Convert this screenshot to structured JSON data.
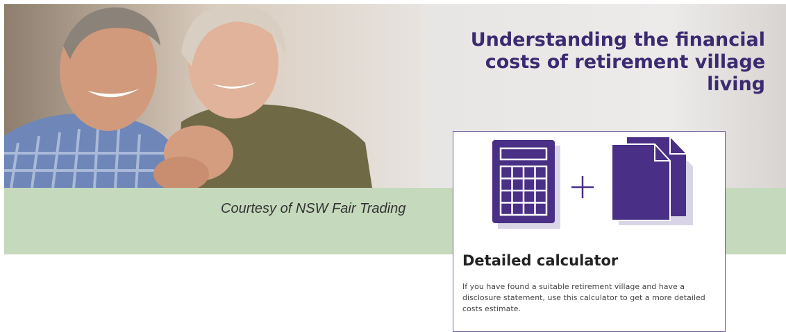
{
  "hero": {
    "title": "Understanding the financial costs of retirement village living",
    "image": "photo-of-smiling-senior-couple"
  },
  "banner": {
    "credit": "Courtesy of NSW Fair Trading"
  },
  "card": {
    "icons": [
      "calculator-icon",
      "plus-icon",
      "documents-icon"
    ],
    "title": "Detailed calculator",
    "description": "If you have found a suitable retirement village and have a disclosure statement, use this calculator to get a more detailed costs estimate."
  },
  "colors": {
    "accent_purple": "#4a2f86",
    "title_purple": "#3b2a70",
    "band_green": "#c5d9bd"
  }
}
